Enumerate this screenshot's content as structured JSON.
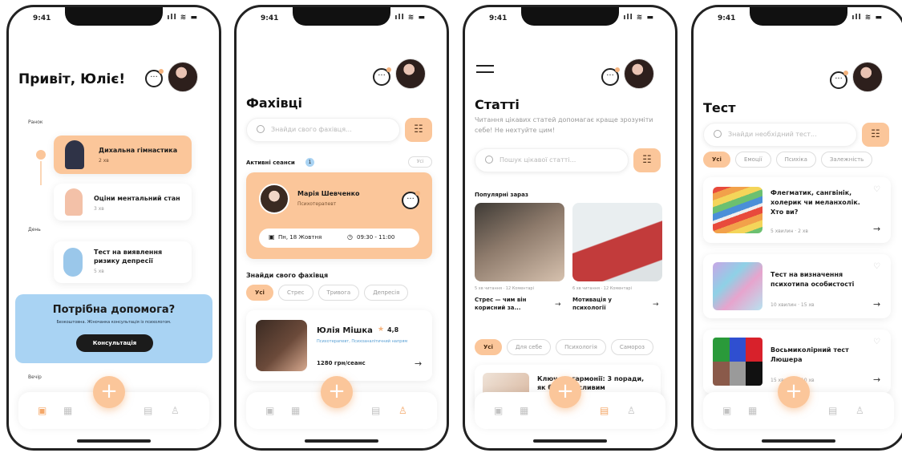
{
  "status": {
    "time": "9:41",
    "icons": "ıll ≋ ▬"
  },
  "home": {
    "greeting": "Привіт, Юліє!",
    "sections": [
      "Ранок",
      "День",
      "Вечір"
    ],
    "items": [
      {
        "title": "Дихальна гімнастика",
        "meta": "2 хв"
      },
      {
        "title": "Оціни ментальний стан",
        "meta": "3 хв"
      },
      {
        "title": "Тест на виявлення ризику депресії",
        "meta": "5 хв"
      }
    ],
    "help": {
      "title": "Потрібна допомога?",
      "subtitle": "Безкоштовна. Жіночанка консультація із психологом.",
      "button": "Консультація"
    }
  },
  "specialists": {
    "title": "Фахівці",
    "search_placeholder": "Знайди свого фахівця...",
    "active_label": "Активні сеанси",
    "active_count": "1",
    "all_label": "Усі",
    "session": {
      "name": "Марія Шевченко",
      "role": "Психотерапевт",
      "date": "Пн, 18 Жовтня",
      "time": "09:30 - 11:00"
    },
    "find_label": "Знайди свого фахівця",
    "chips": [
      "Усі",
      "Стрес",
      "Тривога",
      "Депресія"
    ],
    "specialist": {
      "name": "Юлія Мішка",
      "rating": "4,8",
      "role": "Психотерапевт, Психоаналітичний напрям",
      "price": "1280 грн/сеанс"
    }
  },
  "articles": {
    "title": "Статті",
    "subtitle": "Читання цікавих статей допомагає краще зрозуміти себе! Не нехтуйте цим!",
    "search_placeholder": "Пошук цікавої статті...",
    "popular_label": "Популярні зараз",
    "popular": [
      {
        "meta": "5 хв читання · 12 Коментарі",
        "title": "Стрес — чим він корисний за..."
      },
      {
        "meta": "6 хв читання · 12 Коментарі",
        "title": "Мотивація у психології"
      }
    ],
    "chips": [
      "Усі",
      "Для себе",
      "Психологія",
      "Самороз"
    ],
    "featured": {
      "title": "Ключ до гармонії: 3 поради, як бути щасливим"
    }
  },
  "tests": {
    "title": "Тест",
    "search_placeholder": "Знайди необхідний тест...",
    "chips": [
      "Усі",
      "Емоції",
      "Психіка",
      "Залежність"
    ],
    "items": [
      {
        "title": "Флегматик, сангвінік, холерик чи меланхолік. Хто ви?",
        "meta": "5 хвилин · 2 хв"
      },
      {
        "title": "Тест на визначення психотипа особистості",
        "meta": "10 хвилин · 15 хв"
      },
      {
        "title": "Восьмиколірний тест Люшера",
        "meta": "15 хвилин · 10 хв"
      }
    ]
  },
  "colors": {
    "accent": "#fbc69a",
    "help_bg": "#a9d3f3",
    "dark": "#1b1b1b"
  },
  "icons": [
    "chat-icon",
    "avatar",
    "filter-icon",
    "search-icon",
    "plus-icon",
    "calendar-icon",
    "grid-icon",
    "notes-icon",
    "user-icon",
    "arrow-right-icon",
    "heart-icon",
    "menu-icon",
    "star-icon",
    "clock-icon"
  ]
}
